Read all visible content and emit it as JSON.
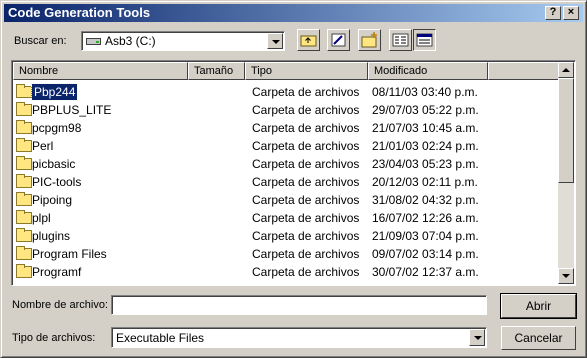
{
  "window": {
    "title": "Code Generation Tools"
  },
  "titlebar": {
    "help_label": "?",
    "close_label": "×"
  },
  "lookin": {
    "label": "Buscar en:",
    "value": "Asb3 (C:)"
  },
  "toolbar": {
    "icons": [
      "up-folder-icon",
      "desktop-icon",
      "new-folder-icon",
      "list-view-icon",
      "details-view-icon"
    ]
  },
  "columns": [
    "Nombre",
    "Tamaño",
    "Tipo",
    "Modificado"
  ],
  "files": [
    {
      "name": "Pbp244",
      "size": "",
      "type": "Carpeta de archivos",
      "modified": "08/11/03 03:40 p.m.",
      "selected": true
    },
    {
      "name": "PBPLUS_LITE",
      "size": "",
      "type": "Carpeta de archivos",
      "modified": "29/07/03 05:22 p.m."
    },
    {
      "name": "pcpgm98",
      "size": "",
      "type": "Carpeta de archivos",
      "modified": "21/07/03 10:45 a.m."
    },
    {
      "name": "Perl",
      "size": "",
      "type": "Carpeta de archivos",
      "modified": "21/01/03 02:24 p.m."
    },
    {
      "name": "picbasic",
      "size": "",
      "type": "Carpeta de archivos",
      "modified": "23/04/03 05:23 p.m."
    },
    {
      "name": "PIC-tools",
      "size": "",
      "type": "Carpeta de archivos",
      "modified": "20/12/03 02:11 p.m."
    },
    {
      "name": "Pipoing",
      "size": "",
      "type": "Carpeta de archivos",
      "modified": "31/08/02 04:32 p.m."
    },
    {
      "name": "plpl",
      "size": "",
      "type": "Carpeta de archivos",
      "modified": "16/07/02 12:26 a.m."
    },
    {
      "name": "plugins",
      "size": "",
      "type": "Carpeta de archivos",
      "modified": "21/09/03 07:04 p.m."
    },
    {
      "name": "Program Files",
      "size": "",
      "type": "Carpeta de archivos",
      "modified": "09/07/02 03:14 p.m."
    },
    {
      "name": "Programf",
      "size": "",
      "type": "Carpeta de archivos",
      "modified": "30/07/02 12:37 a.m."
    }
  ],
  "filename": {
    "label": "Nombre de archivo:",
    "value": ""
  },
  "filetype": {
    "label": "Tipo de archivos:",
    "value": "Executable Files"
  },
  "buttons": {
    "open": "Abrir",
    "cancel": "Cancelar"
  },
  "scrollbar": {
    "position_fraction": 0.0,
    "visible_fraction": 0.55
  }
}
